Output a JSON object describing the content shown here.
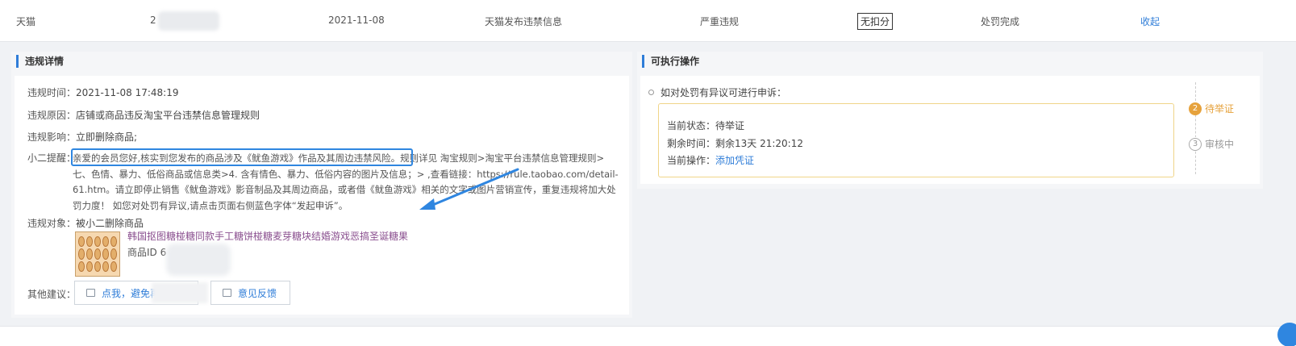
{
  "summary": {
    "platform": "天猫",
    "id_prefix": "2",
    "date": "2021-11-08",
    "type": "天猫发布违禁信息",
    "level": "严重违规",
    "deduct": "无扣分",
    "status": "处罚完成",
    "collapse": "收起"
  },
  "detail": {
    "title": "违规详情",
    "time_label": "违规时间：",
    "time_value": "2021-11-08 17:48:19",
    "reason_label": "违规原因：",
    "reason_value": "店铺或商品违反淘宝平台违禁信息管理规则",
    "impact_label": "违规影响：",
    "impact_value": "立即删除商品;",
    "tip_label": "小二提醒：",
    "tip_text": "亲爱的会员您好,核实到您发布的商品涉及《鱿鱼游戏》作品及其周边违禁风险。规则详见 淘宝规则>淘宝平台违禁信息管理规则>七、色情、暴力、低俗商品或信息类>4. 含有情色、暴力、低俗内容的图片及信息；> ,查看链接：https://rule.taobao.com/detail-61.htm。请立即停止销售《鱿鱼游戏》影音制品及其周边商品，或者借《鱿鱼游戏》相关的文字或图片营销宣传，重复违规将加大处罚力度！ 如您对处罚有异议,请点击页面右侧蓝色字体“发起申诉”。",
    "object_label": "违规对象：",
    "object_value": "被小二删除商品",
    "product_title": "韩国抠图糖椪糖同款手工糖饼椪糖麦芽糖块结婚游戏恶搞圣诞糖果",
    "product_id_label": "商品ID 6",
    "suggest_label": "其他建议：",
    "btn_avoid": "点我，避免再次违规",
    "btn_feedback": "意见反馈"
  },
  "actions": {
    "title": "可执行操作",
    "appeal_hint": "如对处罚有异议可进行申诉：",
    "current_status": "当前状态：待举证",
    "remaining_time": "剩余时间：剩余13天 21:20:12",
    "current_op_label": "当前操作：",
    "current_op_link": "添加凭证",
    "steps": [
      {
        "num": "2",
        "label": "待举证"
      },
      {
        "num": "3",
        "label": "审核中"
      }
    ]
  },
  "colors": {
    "accent": "#2f7dd8",
    "warning": "#e6a23c",
    "highlight_box": "#2f86e0"
  }
}
